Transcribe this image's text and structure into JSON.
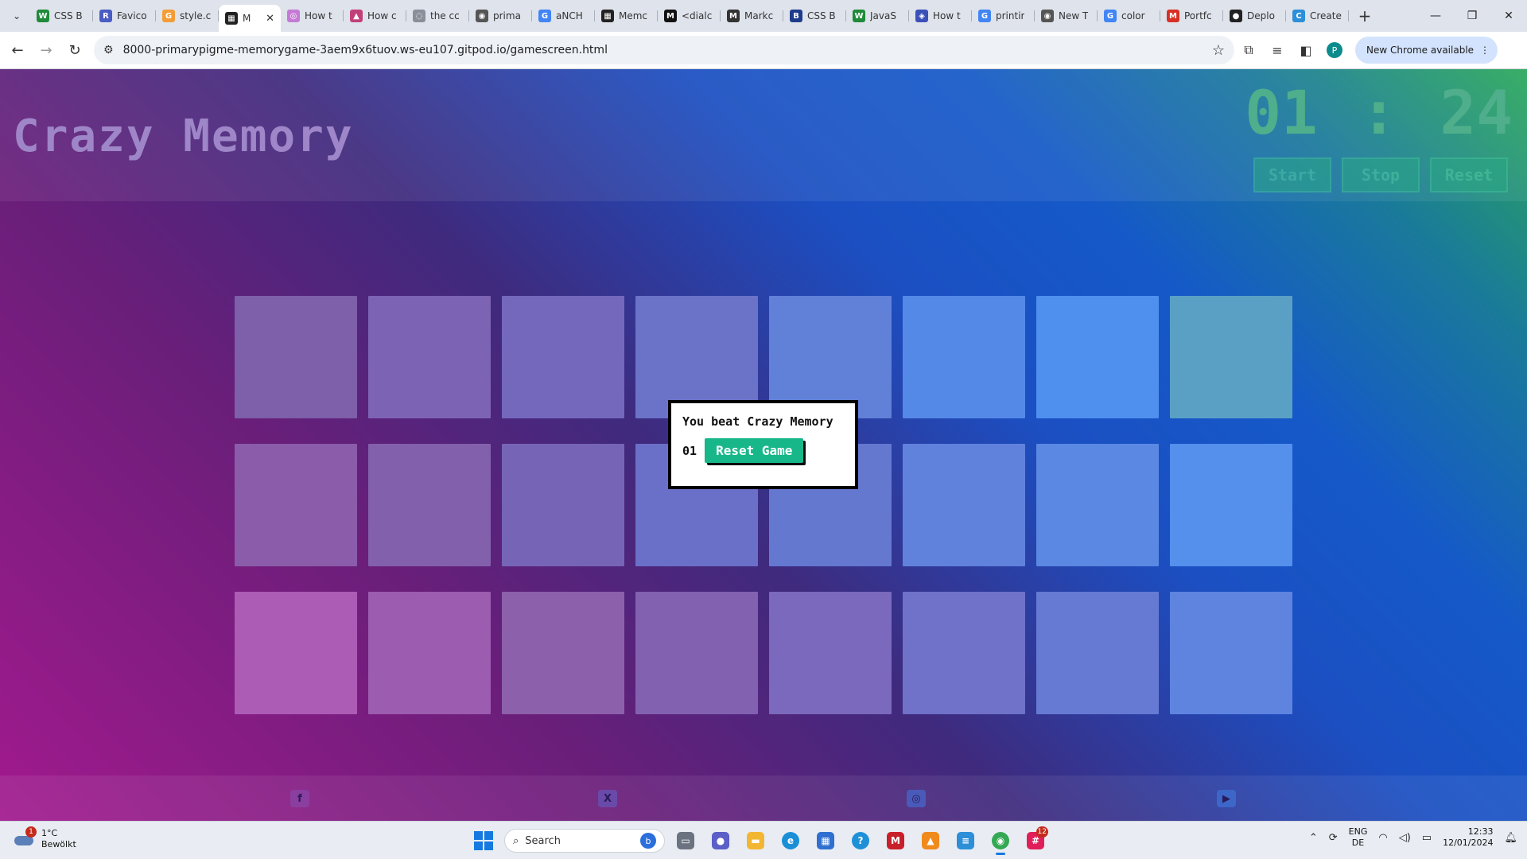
{
  "browser": {
    "tabs": [
      {
        "title": "CSS B",
        "fav": "W",
        "fav_color": "#1f8a3a"
      },
      {
        "title": "Favico",
        "fav": "R",
        "fav_color": "#4b5cc4"
      },
      {
        "title": "style.c",
        "fav": "G",
        "fav_color": "#f29d38"
      },
      {
        "title": "M",
        "fav": "▦",
        "fav_color": "#222222",
        "active": true
      },
      {
        "title": "How t",
        "fav": "◎",
        "fav_color": "#c57bd6"
      },
      {
        "title": "How c",
        "fav": "▲",
        "fav_color": "#c2407a"
      },
      {
        "title": "the cc",
        "fav": "◌",
        "fav_color": "#8a8f99"
      },
      {
        "title": "prima",
        "fav": "◉",
        "fav_color": "#555555"
      },
      {
        "title": "aNCH",
        "fav": "G",
        "fav_color": "#4285f4"
      },
      {
        "title": "Memc",
        "fav": "▦",
        "fav_color": "#222222"
      },
      {
        "title": "<dialc",
        "fav": "M",
        "fav_color": "#111111"
      },
      {
        "title": "Markc",
        "fav": "M",
        "fav_color": "#333333"
      },
      {
        "title": "CSS B",
        "fav": "B",
        "fav_color": "#1e3c8c"
      },
      {
        "title": "JavaS",
        "fav": "W",
        "fav_color": "#1f8a3a"
      },
      {
        "title": "How t",
        "fav": "◈",
        "fav_color": "#3b50b8"
      },
      {
        "title": "printir",
        "fav": "G",
        "fav_color": "#4285f4"
      },
      {
        "title": "New T",
        "fav": "◉",
        "fav_color": "#555555"
      },
      {
        "title": "color",
        "fav": "G",
        "fav_color": "#4285f4"
      },
      {
        "title": "Portfc",
        "fav": "M",
        "fav_color": "#d93025"
      },
      {
        "title": "Deplo",
        "fav": "●",
        "fav_color": "#222222"
      },
      {
        "title": "Create",
        "fav": "C",
        "fav_color": "#2c8fd8"
      }
    ],
    "url": "8000-primarypigme-memorygame-3aem9x6tuov.ws-eu107.gitpod.io/gamescreen.html",
    "update_label": "New Chrome available",
    "profile_initial": "P"
  },
  "game": {
    "title": "Crazy Memory",
    "timer": {
      "minutes": "01",
      "separator": ":",
      "seconds": "24"
    },
    "controls": {
      "start": "Start",
      "stop": "Stop",
      "reset": "Reset"
    },
    "cards": [
      "#7e5faa",
      "#7d63b3",
      "#7468bd",
      "#6a73c8",
      "#6180d8",
      "#5589e8",
      "#4f8fee",
      "#5aa0c5",
      "#8a5caa",
      "#8260ab",
      "#7665b6",
      "#6a70c7",
      "#6478d0",
      "#6182dc",
      "#5a88e2",
      "#5490ec",
      "#ad5cb6",
      "#9c5cb0",
      "#8d60ab",
      "#8262b0",
      "#7a69bc",
      "#6f72c8",
      "#667ad4",
      "#5e84e0"
    ],
    "dialog": {
      "message": "You beat Crazy Memory",
      "score": "01",
      "button": "Reset Game"
    },
    "social": [
      {
        "name": "facebook",
        "glyph": "f",
        "color": "#8a3fa0"
      },
      {
        "name": "x-twitter",
        "glyph": "X",
        "color": "#6a4aa8"
      },
      {
        "name": "instagram",
        "glyph": "◎",
        "color": "#4a5ab8"
      },
      {
        "name": "youtube",
        "glyph": "▶",
        "color": "#3c66c8"
      }
    ]
  },
  "taskbar": {
    "weather_temp": "1°C",
    "weather_desc": "Bewölkt",
    "weather_badge": "1",
    "search_label": "Search",
    "lang_top": "ENG",
    "lang_bottom": "DE",
    "time": "12:33",
    "date": "12/01/2024",
    "app_badge": "12"
  }
}
